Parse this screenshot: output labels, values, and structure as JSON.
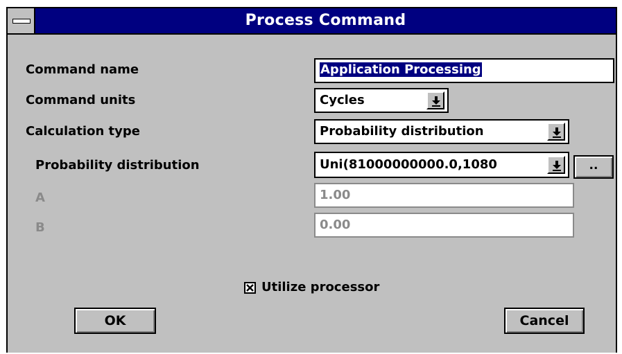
{
  "window": {
    "title": "Process Command"
  },
  "form": {
    "command_name": {
      "label": "Command name",
      "value": "Application Processing"
    },
    "command_units": {
      "label": "Command units",
      "value": "Cycles"
    },
    "calculation_type": {
      "label": "Calculation type",
      "value": "Probability distribution"
    },
    "probability_distribution": {
      "label": "Probability distribution",
      "value": "Uni(81000000000.0,1080",
      "browse_label": ".."
    },
    "param_a": {
      "label": "A",
      "value": "1.00"
    },
    "param_b": {
      "label": "B",
      "value": "0.00"
    },
    "utilize_processor": {
      "label": "Utilize processor",
      "checked": true
    }
  },
  "buttons": {
    "ok": "OK",
    "cancel": "Cancel"
  },
  "icons": {
    "system_menu": "minus-bar-icon",
    "dropdown": "down-arrow-icon",
    "checkbox": "x-check-icon"
  }
}
